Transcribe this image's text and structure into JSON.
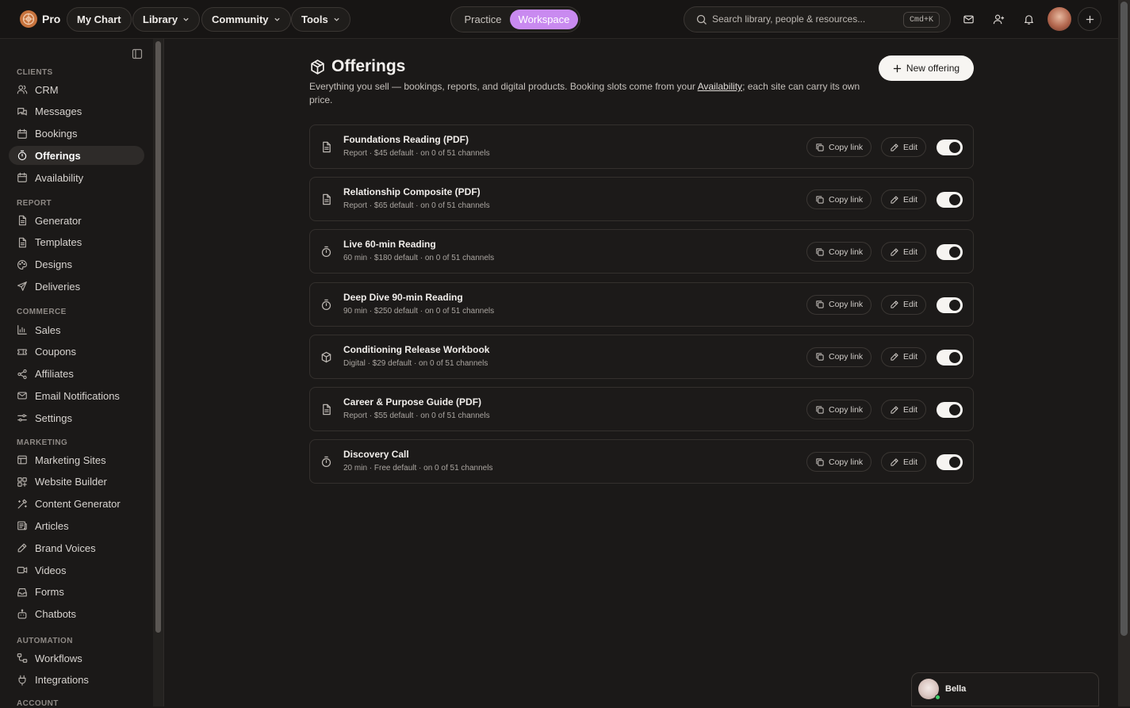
{
  "topbar": {
    "brand": "Pro",
    "nav": [
      {
        "label": "My Chart",
        "dropdown": false
      },
      {
        "label": "Library",
        "dropdown": true
      },
      {
        "label": "Community",
        "dropdown": true
      },
      {
        "label": "Tools",
        "dropdown": true
      }
    ],
    "mode_switch": {
      "options": [
        "Practice",
        "Workspace"
      ],
      "selected": "Workspace"
    },
    "search": {
      "placeholder": "Search library, people & resources...",
      "shortcut": "Cmd+K"
    },
    "icons": [
      "mail-icon",
      "add-person-icon",
      "bell-icon",
      "avatar",
      "plus-icon"
    ]
  },
  "sidebar": {
    "sections": [
      {
        "title": "CLIENTS",
        "items": [
          {
            "label": "CRM",
            "icon": "users-icon"
          },
          {
            "label": "Messages",
            "icon": "messages-icon"
          },
          {
            "label": "Bookings",
            "icon": "calendar-icon"
          },
          {
            "label": "Offerings",
            "icon": "timer-icon",
            "active": true
          },
          {
            "label": "Availability",
            "icon": "calendar-icon"
          }
        ]
      },
      {
        "title": "REPORT",
        "items": [
          {
            "label": "Generator",
            "icon": "doc-icon"
          },
          {
            "label": "Templates",
            "icon": "doc-icon"
          },
          {
            "label": "Designs",
            "icon": "palette-icon"
          },
          {
            "label": "Deliveries",
            "icon": "send-icon"
          }
        ]
      },
      {
        "title": "COMMERCE",
        "items": [
          {
            "label": "Sales",
            "icon": "bar-chart-icon"
          },
          {
            "label": "Coupons",
            "icon": "ticket-icon"
          },
          {
            "label": "Affiliates",
            "icon": "share-icon"
          },
          {
            "label": "Email Notifications",
            "icon": "mail-icon"
          },
          {
            "label": "Settings",
            "icon": "sliders-icon"
          }
        ]
      },
      {
        "title": "MARKETING",
        "items": [
          {
            "label": "Marketing Sites",
            "icon": "layout-icon"
          },
          {
            "label": "Website Builder",
            "icon": "blocks-icon"
          },
          {
            "label": "Content Generator",
            "icon": "wand-icon"
          },
          {
            "label": "Articles",
            "icon": "newspaper-icon"
          },
          {
            "label": "Brand Voices",
            "icon": "pen-icon"
          },
          {
            "label": "Videos",
            "icon": "video-icon"
          },
          {
            "label": "Forms",
            "icon": "inbox-icon"
          },
          {
            "label": "Chatbots",
            "icon": "bot-icon"
          }
        ]
      },
      {
        "title": "AUTOMATION",
        "items": [
          {
            "label": "Workflows",
            "icon": "workflow-icon"
          },
          {
            "label": "Integrations",
            "icon": "plug-icon"
          }
        ]
      },
      {
        "title": "ACCOUNT",
        "items": []
      }
    ]
  },
  "page": {
    "title": "Offerings",
    "description_before": "Everything you sell — bookings, reports, and digital products. Booking slots come from your ",
    "description_link": "Availability",
    "description_after": "; each site can carry its own price.",
    "new_button": "New offering",
    "copy_label": "Copy link",
    "edit_label": "Edit"
  },
  "offerings": [
    {
      "name": "Foundations Reading (PDF)",
      "meta": "Report · $45 default · on 0 of 51 channels",
      "icon": "document-icon",
      "enabled": true
    },
    {
      "name": "Relationship Composite (PDF)",
      "meta": "Report · $65 default · on 0 of 51 channels",
      "icon": "document-icon",
      "enabled": true
    },
    {
      "name": "Live 60-min Reading",
      "meta": "60 min · $180 default · on 0 of 51 channels",
      "icon": "timer-icon",
      "enabled": true
    },
    {
      "name": "Deep Dive 90-min Reading",
      "meta": "90 min · $250 default · on 0 of 51 channels",
      "icon": "timer-icon",
      "enabled": true
    },
    {
      "name": "Conditioning Release Workbook",
      "meta": "Digital · $29 default · on 0 of 51 channels",
      "icon": "package-icon",
      "enabled": true
    },
    {
      "name": "Career & Purpose Guide (PDF)",
      "meta": "Report · $55 default · on 0 of 51 channels",
      "icon": "document-icon",
      "enabled": true
    },
    {
      "name": "Discovery Call",
      "meta": "20 min · Free default · on 0 of 51 channels",
      "icon": "timer-icon",
      "enabled": true
    }
  ],
  "chat": {
    "name": "Bella"
  },
  "colors": {
    "accent": "#c98af0",
    "background": "#1b1918",
    "card": "#1c1a19",
    "border": "#34302d"
  }
}
